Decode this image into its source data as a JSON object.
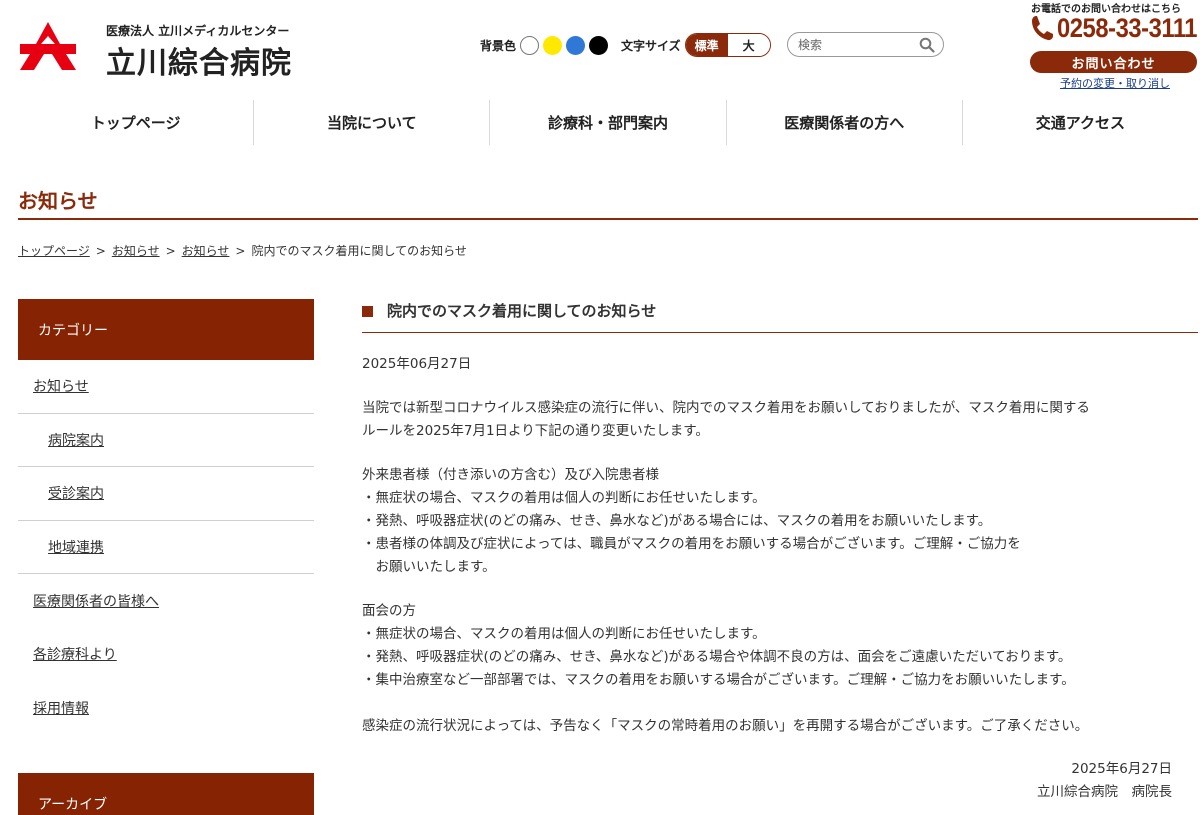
{
  "header": {
    "logo_subtitle": "医療法人 立川メディカルセンター",
    "logo_name": "立川綜合病院",
    "bg_color_label": "背景色",
    "bg_swatches": [
      "#ffffff",
      "#ffe900",
      "#2f78d6",
      "#000000"
    ],
    "font_size_label": "文字サイズ",
    "font_size_options": [
      "標準",
      "大"
    ],
    "font_size_selected": "標準",
    "search_placeholder": "検索",
    "phone_caption": "お電話でのお問い合わせはこちら",
    "phone_number": "0258-33-3111",
    "contact_label": "お問い合わせ",
    "reserve_link": "予約の変更・取り消し"
  },
  "nav": {
    "items": [
      "トップページ",
      "当院について",
      "診療科・部門案内",
      "医療関係者の方へ",
      "交通アクセス"
    ]
  },
  "page": {
    "title": "お知らせ",
    "breadcrumb": [
      "トップページ",
      "お知らせ",
      "お知らせ",
      "院内でのマスク着用に関してのお知らせ"
    ],
    "breadcrumb_sep": ">"
  },
  "sidebar": {
    "category_heading": "カテゴリー",
    "items": [
      "お知らせ",
      "病院案内",
      "受診案内",
      "地域連携",
      "医療関係者の皆様へ",
      "各診療科より",
      "採用情報"
    ],
    "archive_heading": "アーカイブ"
  },
  "article": {
    "title": "院内でのマスク着用に関してのお知らせ",
    "date": "2025年06月27日",
    "intro": [
      "当院では新型コロナウイルス感染症の流行に伴い、院内でのマスク着用をお願いしておりましたが、マスク着用に関する",
      "ルールを2025年7月1日より下記の通り変更いたします。"
    ],
    "section1": {
      "heading": "外来患者様（付き添いの方含む）及び入院患者様",
      "lines": [
        "・無症状の場合、マスクの着用は個人の判断にお任せいたします。",
        "・発熱、呼吸器症状(のどの痛み、せき、鼻水など)がある場合には、マスクの着用をお願いいたします。",
        "・患者様の体調及び症状によっては、職員がマスクの着用をお願いする場合がございます。ご理解・ご協力を",
        "　お願いいたします。"
      ]
    },
    "section2": {
      "heading": "面会の方",
      "lines": [
        "・無症状の場合、マスクの着用は個人の判断にお任せいたします。",
        "・発熱、呼吸器症状(のどの痛み、せき、鼻水など)がある場合や体調不良の方は、面会をご遠慮いただいております。",
        "・集中治療室など一部部署では、マスクの着用をお願いする場合がございます。ご理解・ご協力をお願いいたします。"
      ]
    },
    "closing": "感染症の流行状況によっては、予告なく「マスクの常時着用のお願い」を再開する場合がございます。ご了承ください。",
    "sign_date": "2025年6月27日",
    "signature": "立川綜合病院　病院長"
  },
  "colors": {
    "brand": "#8a2a0a",
    "sidebar_head": "#862302",
    "logo_red": "#e60012"
  }
}
